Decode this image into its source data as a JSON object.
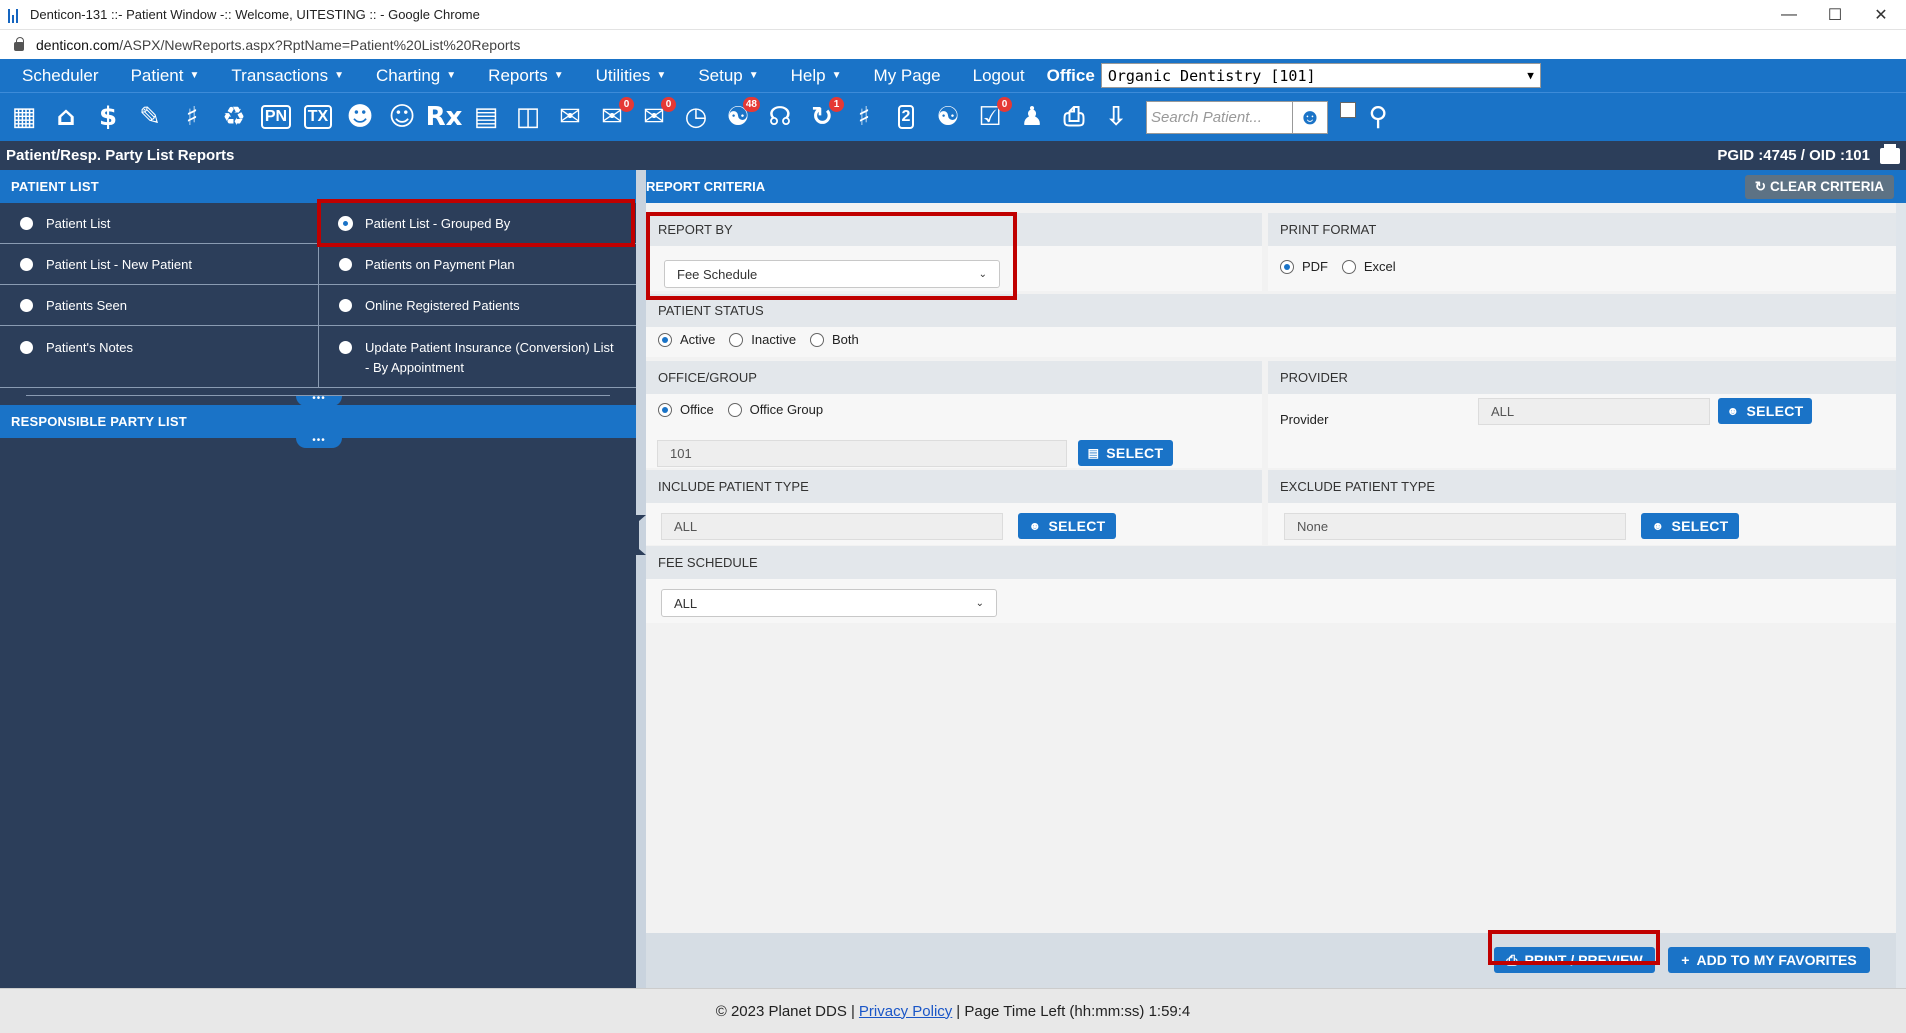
{
  "window": {
    "title": "Denticon-131 ::- Patient Window -:: Welcome, UITESTING :: - Google Chrome",
    "url_host": "denticon.com",
    "url_path": "/ASPX/NewReports.aspx?RptName=Patient%20List%20Reports"
  },
  "menu": {
    "items": [
      "Scheduler",
      "Patient",
      "Transactions",
      "Charting",
      "Reports",
      "Utilities",
      "Setup",
      "Help",
      "My Page",
      "Logout"
    ],
    "office_label": "Office",
    "office_value": "Organic Dentistry [101]"
  },
  "toolbar": {
    "search_placeholder": "Search Patient...",
    "badge_messages": "0",
    "badge_sms": "0",
    "badge_web": "48",
    "badge_alerts": "1",
    "badge_tasks": "0",
    "label_pn": "PN",
    "label_tx": "TX",
    "label_rx": "Rx",
    "label_2": "2"
  },
  "page": {
    "title": "Patient/Resp. Party List Reports",
    "pgid": "PGID :4745  /  OID :101"
  },
  "left": {
    "patient_list_header": "PATIENT LIST",
    "options": [
      "Patient List",
      "Patient List - Grouped By",
      "Patient List - New Patient",
      "Patients on Payment Plan",
      "Patients Seen",
      "Online Registered Patients",
      "Patient's Notes",
      "Update Patient Insurance (Conversion) List - By Appointment"
    ],
    "resp_party_header": "RESPONSIBLE PARTY LIST"
  },
  "criteria": {
    "header": "REPORT CRITERIA",
    "clear_button": "CLEAR CRITERIA",
    "report_by_label": "REPORT BY",
    "report_by_value": "Fee Schedule",
    "print_format_label": "PRINT FORMAT",
    "print_format_options": [
      "PDF",
      "Excel"
    ],
    "patient_status_label": "PATIENT STATUS",
    "patient_status_options": [
      "Active",
      "Inactive",
      "Both"
    ],
    "office_group_label": "OFFICE/GROUP",
    "office_group_options": [
      "Office",
      "Office Group"
    ],
    "office_value": "101",
    "provider_section_label": "PROVIDER",
    "provider_label": "Provider",
    "provider_value": "ALL",
    "select_label": "SELECT",
    "include_type_label": "INCLUDE PATIENT TYPE",
    "include_type_value": "ALL",
    "exclude_type_label": "EXCLUDE PATIENT TYPE",
    "exclude_type_value": "None",
    "fee_schedule_label": "FEE SCHEDULE",
    "fee_schedule_value": "ALL",
    "print_preview_button": "PRINT / PREVIEW",
    "add_favorites_button": "ADD TO MY FAVORITES"
  },
  "footer": {
    "copyright": "© 2023 Planet DDS |",
    "privacy": "Privacy Policy",
    "time_left": "|  Page Time Left (hh:mm:ss) 1:59:4"
  },
  "colors": {
    "primary_blue": "#1a73c7",
    "navy": "#2c3e5a",
    "highlight_red": "#c00000"
  }
}
